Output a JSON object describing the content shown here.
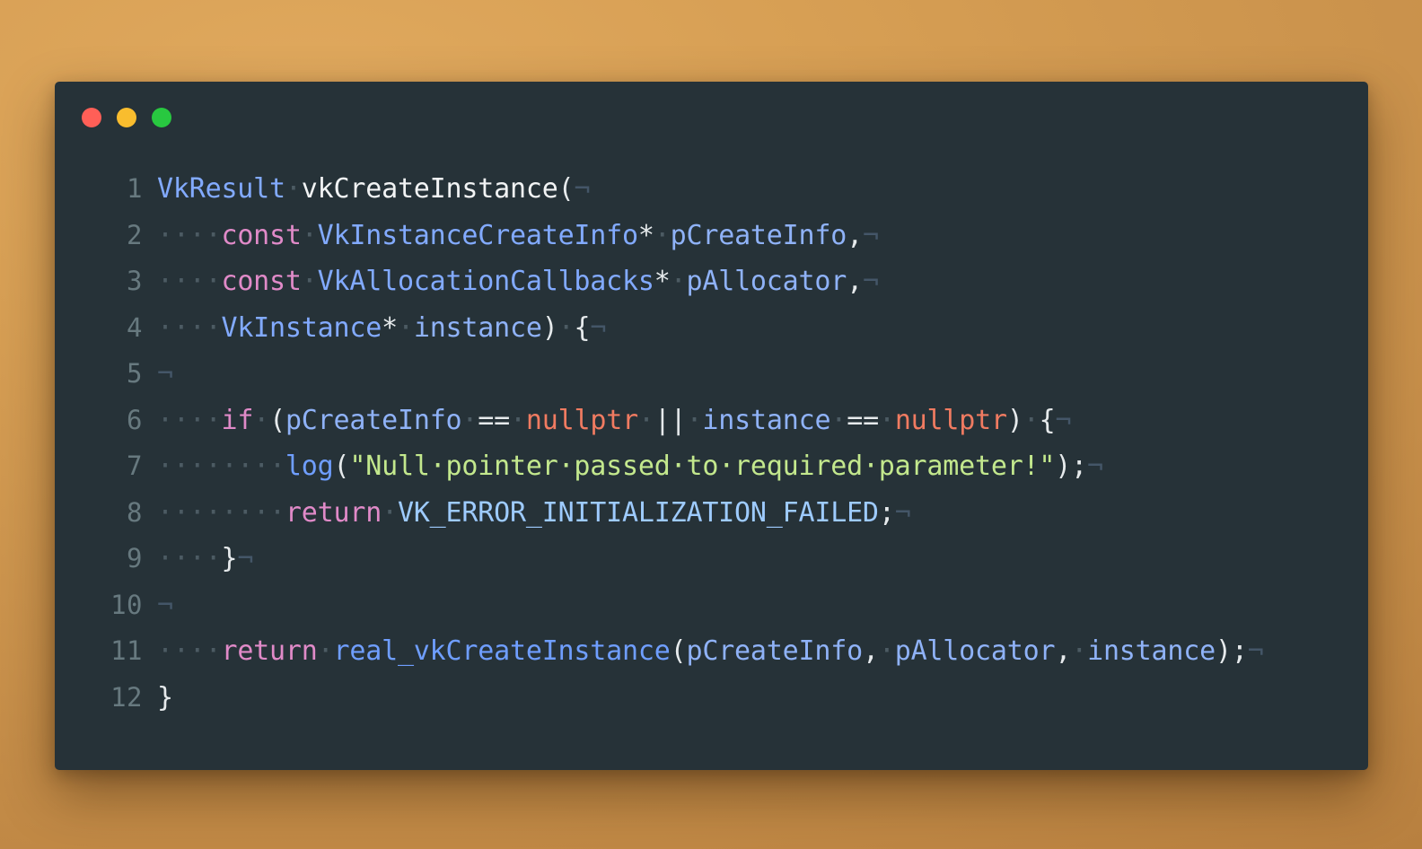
{
  "window": {
    "traffic_lights": [
      {
        "name": "close",
        "color": "#ff5f57"
      },
      {
        "name": "minimize",
        "color": "#f9bd2e"
      },
      {
        "name": "zoom",
        "color": "#28c840"
      }
    ]
  },
  "editor": {
    "language": "cpp",
    "whitespace_marker": "·",
    "eol_marker": "¬",
    "line_numbers": [
      "1",
      "2",
      "3",
      "4",
      "5",
      "6",
      "7",
      "8",
      "9",
      "10",
      "11",
      "12"
    ],
    "lines": [
      {
        "number": "1",
        "text": "VkResult vkCreateInstance(",
        "tokens": [
          {
            "kind": "type",
            "text": "VkResult"
          },
          {
            "kind": "ws",
            "text": "·"
          },
          {
            "kind": "fn",
            "text": "vkCreateInstance"
          },
          {
            "kind": "op",
            "text": "("
          },
          {
            "kind": "eol",
            "text": "¬"
          }
        ]
      },
      {
        "number": "2",
        "text": "    const VkInstanceCreateInfo* pCreateInfo,",
        "tokens": [
          {
            "kind": "ws",
            "text": "····"
          },
          {
            "kind": "kw",
            "text": "const"
          },
          {
            "kind": "ws",
            "text": "·"
          },
          {
            "kind": "type",
            "text": "VkInstanceCreateInfo"
          },
          {
            "kind": "op",
            "text": "*"
          },
          {
            "kind": "ws",
            "text": "·"
          },
          {
            "kind": "var",
            "text": "pCreateInfo"
          },
          {
            "kind": "op",
            "text": ","
          },
          {
            "kind": "eol",
            "text": "¬"
          }
        ]
      },
      {
        "number": "3",
        "text": "    const VkAllocationCallbacks* pAllocator,",
        "tokens": [
          {
            "kind": "ws",
            "text": "····"
          },
          {
            "kind": "kw",
            "text": "const"
          },
          {
            "kind": "ws",
            "text": "·"
          },
          {
            "kind": "type",
            "text": "VkAllocationCallbacks"
          },
          {
            "kind": "op",
            "text": "*"
          },
          {
            "kind": "ws",
            "text": "·"
          },
          {
            "kind": "var",
            "text": "pAllocator"
          },
          {
            "kind": "op",
            "text": ","
          },
          {
            "kind": "eol",
            "text": "¬"
          }
        ]
      },
      {
        "number": "4",
        "text": "    VkInstance* instance) {",
        "tokens": [
          {
            "kind": "ws",
            "text": "····"
          },
          {
            "kind": "type",
            "text": "VkInstance"
          },
          {
            "kind": "op",
            "text": "*"
          },
          {
            "kind": "ws",
            "text": "·"
          },
          {
            "kind": "var",
            "text": "instance"
          },
          {
            "kind": "op",
            "text": ")"
          },
          {
            "kind": "ws",
            "text": "·"
          },
          {
            "kind": "op",
            "text": "{"
          },
          {
            "kind": "eol",
            "text": "¬"
          }
        ]
      },
      {
        "number": "5",
        "text": "",
        "tokens": [
          {
            "kind": "eol",
            "text": "¬"
          }
        ]
      },
      {
        "number": "6",
        "text": "    if (pCreateInfo == nullptr || instance == nullptr) {",
        "tokens": [
          {
            "kind": "ws",
            "text": "····"
          },
          {
            "kind": "kw",
            "text": "if"
          },
          {
            "kind": "ws",
            "text": "·"
          },
          {
            "kind": "op",
            "text": "("
          },
          {
            "kind": "var",
            "text": "pCreateInfo"
          },
          {
            "kind": "ws",
            "text": "·"
          },
          {
            "kind": "op",
            "text": "=="
          },
          {
            "kind": "ws",
            "text": "·"
          },
          {
            "kind": "const",
            "text": "nullptr"
          },
          {
            "kind": "ws",
            "text": "·"
          },
          {
            "kind": "op",
            "text": "||"
          },
          {
            "kind": "ws",
            "text": "·"
          },
          {
            "kind": "var",
            "text": "instance"
          },
          {
            "kind": "ws",
            "text": "·"
          },
          {
            "kind": "op",
            "text": "=="
          },
          {
            "kind": "ws",
            "text": "·"
          },
          {
            "kind": "const",
            "text": "nullptr"
          },
          {
            "kind": "op",
            "text": ")"
          },
          {
            "kind": "ws",
            "text": "·"
          },
          {
            "kind": "op",
            "text": "{"
          },
          {
            "kind": "eol",
            "text": "¬"
          }
        ]
      },
      {
        "number": "7",
        "text": "        log(\"Null pointer passed to required parameter!\");",
        "tokens": [
          {
            "kind": "ws",
            "text": "········"
          },
          {
            "kind": "fncall",
            "text": "log"
          },
          {
            "kind": "op",
            "text": "("
          },
          {
            "kind": "str",
            "text": "\"Null·pointer·passed·to·required·parameter!\""
          },
          {
            "kind": "op",
            "text": ")"
          },
          {
            "kind": "op",
            "text": ";"
          },
          {
            "kind": "eol",
            "text": "¬"
          }
        ]
      },
      {
        "number": "8",
        "text": "        return VK_ERROR_INITIALIZATION_FAILED;",
        "tokens": [
          {
            "kind": "ws",
            "text": "········"
          },
          {
            "kind": "kw",
            "text": "return"
          },
          {
            "kind": "ws",
            "text": "·"
          },
          {
            "kind": "macro",
            "text": "VK_ERROR_INITIALIZATION_FAILED"
          },
          {
            "kind": "op",
            "text": ";"
          },
          {
            "kind": "eol",
            "text": "¬"
          }
        ]
      },
      {
        "number": "9",
        "text": "    }",
        "tokens": [
          {
            "kind": "ws",
            "text": "····"
          },
          {
            "kind": "op",
            "text": "}"
          },
          {
            "kind": "eol",
            "text": "¬"
          }
        ]
      },
      {
        "number": "10",
        "text": "",
        "tokens": [
          {
            "kind": "eol",
            "text": "¬"
          }
        ]
      },
      {
        "number": "11",
        "text": "    return real_vkCreateInstance(pCreateInfo, pAllocator, instance);",
        "tokens": [
          {
            "kind": "ws",
            "text": "····"
          },
          {
            "kind": "kw",
            "text": "return"
          },
          {
            "kind": "ws",
            "text": "·"
          },
          {
            "kind": "fncall",
            "text": "real_vkCreateInstance"
          },
          {
            "kind": "op",
            "text": "("
          },
          {
            "kind": "var",
            "text": "pCreateInfo"
          },
          {
            "kind": "op",
            "text": ","
          },
          {
            "kind": "ws",
            "text": "·"
          },
          {
            "kind": "var",
            "text": "pAllocator"
          },
          {
            "kind": "op",
            "text": ","
          },
          {
            "kind": "ws",
            "text": "·"
          },
          {
            "kind": "var",
            "text": "instance"
          },
          {
            "kind": "op",
            "text": ")"
          },
          {
            "kind": "op",
            "text": ";"
          },
          {
            "kind": "eol",
            "text": "¬"
          }
        ]
      },
      {
        "number": "12",
        "text": "}",
        "tokens": [
          {
            "kind": "op",
            "text": "}"
          }
        ]
      }
    ]
  },
  "colors": {
    "background_gradient_start": "#e0a95e",
    "background_gradient_end": "#b8803f",
    "window_background": "#263238",
    "line_number": "#67797f",
    "keyword": "#e08ac8",
    "type": "#82aaff",
    "function_declaration": "#f1f3f4",
    "function_call": "#6f9eff",
    "variable": "#8fb2f7",
    "constant_nullptr": "#f07b61",
    "macro": "#9ecbff",
    "string": "#c3e88d",
    "operator": "#e6eaec",
    "whitespace_marker": "#4c5b63",
    "eol_marker": "#445668"
  }
}
